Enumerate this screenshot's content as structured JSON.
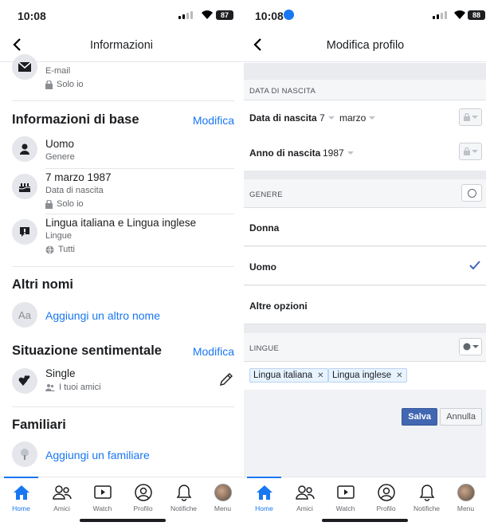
{
  "left": {
    "status": {
      "time": "10:08",
      "battery": "87"
    },
    "nav": {
      "title": "Informazioni"
    },
    "contact": {
      "label": "E-mail",
      "privacy": "Solo io"
    },
    "basic": {
      "heading": "Informazioni di base",
      "edit": "Modifica",
      "gender": {
        "value": "Uomo",
        "label": "Genere"
      },
      "birth": {
        "value": "7 marzo 1987",
        "label": "Data di nascita",
        "privacy": "Solo io"
      },
      "lang": {
        "value": "Lingua italiana e Lingua inglese",
        "label": "Lingue",
        "privacy": "Tutti"
      }
    },
    "other_names": {
      "heading": "Altri nomi",
      "add": "Aggiungi un altro nome",
      "icon_text": "Aa"
    },
    "relationship": {
      "heading": "Situazione sentimentale",
      "edit": "Modifica",
      "value": "Single",
      "privacy": "I tuoi amici"
    },
    "family": {
      "heading": "Familiari",
      "add": "Aggiungi un familiare"
    }
  },
  "right": {
    "status": {
      "time": "10:08",
      "battery": "88"
    },
    "nav": {
      "title": "Modifica profilo"
    },
    "birth_section": "DATA DI NASCITA",
    "birth_date_label": "Data di nascita",
    "day": "7",
    "month": "marzo",
    "birth_year_label": "Anno di nascita",
    "year": "1987",
    "gender_section": "GENERE",
    "gender_options": [
      "Donna",
      "Uomo",
      "Altre opzioni"
    ],
    "languages_section": "LINGUE",
    "languages": [
      "Lingua italiana",
      "Lingua inglese"
    ],
    "save": "Salva",
    "cancel": "Annulla"
  },
  "tabs": [
    "Home",
    "Amici",
    "Watch",
    "Profilo",
    "Notifiche",
    "Menu"
  ],
  "colors": {
    "accent": "#1877f2",
    "save": "#4267b2"
  }
}
